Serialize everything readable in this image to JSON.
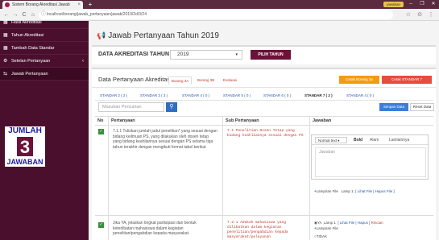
{
  "browser": {
    "tab_title": "Sistem Borang Akreditasi Jawab",
    "tab_close": "×",
    "new_tab": "+",
    "profile": "jawaban",
    "window_controls": [
      "–",
      "❐",
      "✕"
    ],
    "url": "localhost/borang/jawab_pertanyaan/jawab/2019/2d/3/24",
    "nav": [
      "←",
      "→",
      "C",
      "⌂"
    ],
    "bar_icons": [
      "☆",
      "⊙",
      "⋮"
    ]
  },
  "sidebar": {
    "items": [
      {
        "icon": "▦",
        "label": "Hasil Akreditasi",
        "chevron": ""
      },
      {
        "icon": "▦",
        "label": "Tahun Akreditasi",
        "chevron": ""
      },
      {
        "icon": "▦",
        "label": "Tambah Data Standar",
        "chevron": ""
      },
      {
        "icon": "⚙",
        "label": "Setelan Pertanyaan",
        "chevron": "‹"
      },
      {
        "icon": "⇆",
        "label": "Jawab Pertanyaan",
        "chevron": ""
      }
    ]
  },
  "overlay": {
    "line1": "JUMLAH",
    "count": "3",
    "line2": "JAWABAN"
  },
  "main": {
    "title_icon": "📢",
    "title": "Jawab Pertanyaan Tahun 2019",
    "year_label": "DATA AKREDITASI TAHUN",
    "year_value": "2019",
    "pilih_button": "PILIH TAHUN",
    "section_title": "Data Pertanyaan Akreditasi",
    "standard_tabs": [
      "Borang 3A",
      "Borang 3B",
      "Evaluasi"
    ],
    "print_button": "Cetak Borang 3a",
    "print_standard_button": "Cetak STANDAR 7",
    "sub_tabs": [
      "STANDAR 2 ( 2 )",
      "STANDAR 3 ( 3 )",
      "STANDAR 4 ( 0 )",
      "STANDAR 5 ( 0 )",
      "STANDAR 6 ( 0 )",
      "STANDAR 7 ( 2 )",
      "STANDAR 4 ( 0 )"
    ],
    "search_placeholder": "Masukan Pencarian",
    "save_button": "Simpan Data",
    "reset_button": "Reset Data",
    "table_headers": [
      "No",
      "Pertanyaan",
      "Sub Pertanyaan",
      "Jawaban"
    ]
  },
  "rows": [
    {
      "question": "7.1.1 Tuliskan jumlah judul penelitian* yang sesuai dengan bidang keilmuan PS, yang dilakukan oleh dosen tetap yang bidang keahliannya sesuai dengan PS selama tiga tahun terakhir dengan mengikuti format tabel berikut",
      "sub_question": "7.1 Penelitian Dosen Tetap yang bidang keahliannya sesuai dengan PS",
      "editor_font": "Normal text ▾",
      "editor_tools": [
        "Bold",
        "Alam",
        "Lainlainnya"
      ],
      "editor_placeholder": "Jawaban",
      "attach_label": "Lampiran File",
      "attach_file": "Lamp 1",
      "attach_links": "[ Lihat File | Hapus File ]"
    },
    {
      "question": "Jika YA, jelaskan tingkat partisipasi dan bentuk keterlibatan mahasiswa dalam kegiatan penelitian/pengabdian kepada masyarakat.",
      "sub_question": "7.2.1 Adakah mahasiswa yang dilibatkan dalam kegiatan penelitian/pengabdian kepada masyarakat/pelayanan",
      "option_ya": "YA",
      "ya_file": "Lamp 1",
      "ya_links": "[ Lihat File | Hapus ]",
      "ya_extra": "Rincian",
      "attach_label": "Lampiran File",
      "option_tidak": "TIDAK"
    }
  ]
}
